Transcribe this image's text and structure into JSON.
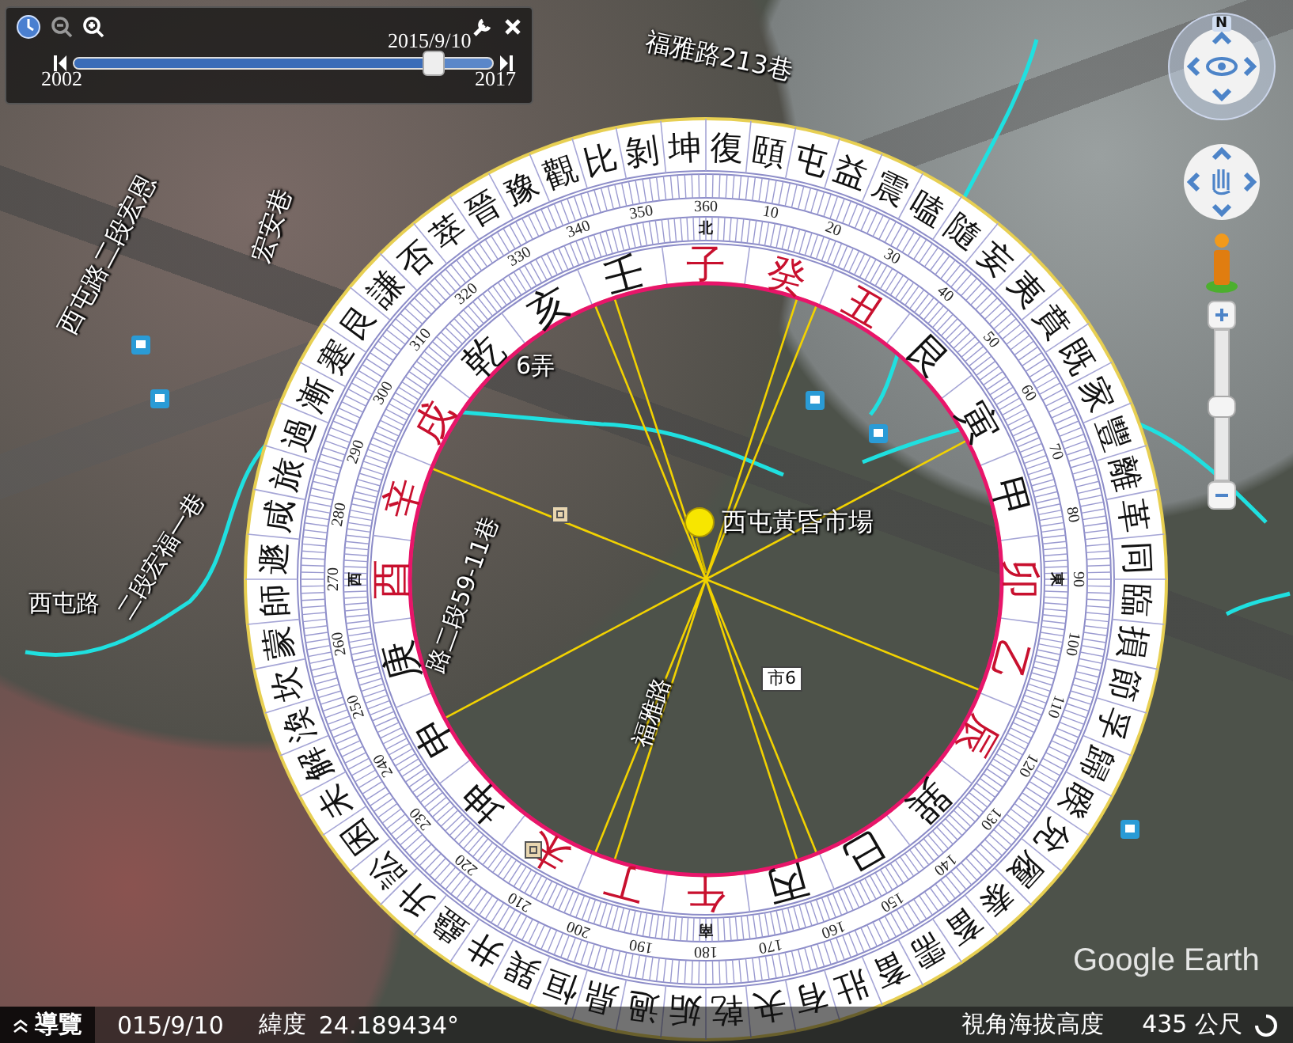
{
  "time_slider": {
    "date": "2015/9/10",
    "start": "2002",
    "end": "2017",
    "level": 0.86
  },
  "map_labels": [
    {
      "text": "福雅路213巷"
    },
    {
      "text": "宏安巷"
    },
    {
      "text": "西屯路二段宏恩"
    },
    {
      "text": "6弄"
    },
    {
      "text": "西屯黃昏市場"
    },
    {
      "text": "路二段59-11巷"
    },
    {
      "text": "福雅路"
    },
    {
      "text": "西屯路"
    },
    {
      "text": "二段宏福一巷"
    }
  ],
  "route_shield": "市6",
  "compass": {
    "hexagrams": [
      "復",
      "頤",
      "屯",
      "益",
      "震",
      "嗑",
      "隨",
      "妄",
      "夷",
      "賁",
      "既",
      "家",
      "豐",
      "離",
      "革",
      "同",
      "臨",
      "損",
      "節",
      "孚",
      "歸",
      "睽",
      "兌",
      "履",
      "泰",
      "畜",
      "需",
      "畜",
      "壯",
      "有",
      "夬",
      "乾",
      "姤",
      "過",
      "鼎",
      "恒",
      "巽",
      "井",
      "蠱",
      "升",
      "訟",
      "困",
      "未",
      "解",
      "渙",
      "坎",
      "蒙",
      "師",
      "遯",
      "咸",
      "旅",
      "過",
      "漸",
      "蹇",
      "艮",
      "謙",
      "否",
      "萃",
      "晉",
      "豫",
      "觀",
      "比",
      "剝",
      "坤"
    ],
    "degrees": [
      "360",
      "10",
      "20",
      "30",
      "40",
      "50",
      "60",
      "70",
      "80",
      "90",
      "100",
      "110",
      "120",
      "130",
      "140",
      "150",
      "160",
      "170",
      "180",
      "190",
      "200",
      "210",
      "220",
      "230",
      "240",
      "250",
      "260",
      "270",
      "280",
      "290",
      "300",
      "310",
      "320",
      "330",
      "340",
      "350"
    ],
    "directions": [
      "北",
      "東",
      "南",
      "西"
    ],
    "mountains": [
      {
        "text": "子",
        "color": "#c8102e"
      },
      {
        "text": "癸",
        "color": "#c8102e"
      },
      {
        "text": "丑",
        "color": "#c8102e"
      },
      {
        "text": "艮",
        "color": "#111111"
      },
      {
        "text": "寅",
        "color": "#111111"
      },
      {
        "text": "甲",
        "color": "#111111"
      },
      {
        "text": "卯",
        "color": "#c8102e"
      },
      {
        "text": "乙",
        "color": "#c8102e"
      },
      {
        "text": "辰",
        "color": "#c8102e"
      },
      {
        "text": "巽",
        "color": "#111111"
      },
      {
        "text": "巳",
        "color": "#111111"
      },
      {
        "text": "丙",
        "color": "#111111"
      },
      {
        "text": "午",
        "color": "#c8102e"
      },
      {
        "text": "丁",
        "color": "#c8102e"
      },
      {
        "text": "未",
        "color": "#c8102e"
      },
      {
        "text": "坤",
        "color": "#111111"
      },
      {
        "text": "申",
        "color": "#111111"
      },
      {
        "text": "庚",
        "color": "#111111"
      },
      {
        "text": "酉",
        "color": "#c8102e"
      },
      {
        "text": "辛",
        "color": "#c8102e"
      },
      {
        "text": "戌",
        "color": "#c8102e"
      },
      {
        "text": "乾",
        "color": "#111111"
      },
      {
        "text": "亥",
        "color": "#111111"
      },
      {
        "text": "壬",
        "color": "#111111"
      }
    ]
  },
  "navigation": {
    "north": "N",
    "zoom_slider": {
      "level": 0.5
    }
  },
  "logo": "Google Earth",
  "status_bar": {
    "tour_button": "導覽",
    "date": "015/9/10",
    "latitude_label": "緯度",
    "latitude": "24.189434°",
    "altitude_label": "視角海拔高度",
    "altitude": "435 公尺"
  }
}
